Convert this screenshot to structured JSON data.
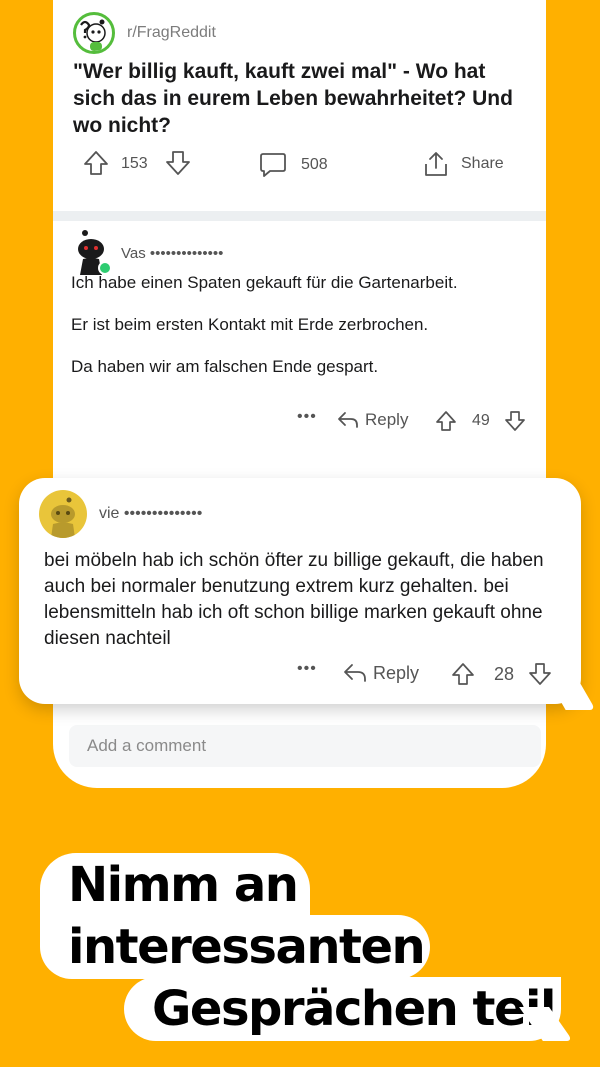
{
  "post": {
    "subreddit": "r/FragReddit",
    "title": "\"Wer billig kauft, kauft zwei mal\" - Wo hat sich das in eurem Leben bewahrheitet? Und wo nicht?",
    "upvotes": "153",
    "comments": "508",
    "share_label": "Share",
    "icons": [
      "upvote-icon",
      "downvote-icon",
      "comment-icon",
      "share-icon"
    ]
  },
  "comment1": {
    "username": "Vas ••••••••••••••",
    "paragraphs": [
      "Ich habe einen Spaten gekauft für die Gartenarbeit.",
      "Er ist beim ersten Kontakt mit Erde zerbrochen.",
      "Da haben wir am falschen Ende gespart."
    ],
    "more": "•••",
    "reply_label": "Reply",
    "votes": "49"
  },
  "comment2": {
    "username": "vie ••••••••••••••",
    "body": "bei möbeln hab ich schön öfter zu billige gekauft, die haben auch bei normaler benutzung extrem kurz gehalten. bei lebensmitteln hab ich oft schon billige marken gekauft ohne diesen nachteil",
    "more": "•••",
    "reply_label": "Reply",
    "votes": "28"
  },
  "add_comment": {
    "placeholder": "Add a comment"
  },
  "headline": {
    "line1": "Nimm an",
    "line2": "interessanten",
    "line3": "Gesprächen teil"
  },
  "colors": {
    "background": "#FFB000",
    "card": "#FFFFFF",
    "online_dot": "#2ECC71"
  }
}
